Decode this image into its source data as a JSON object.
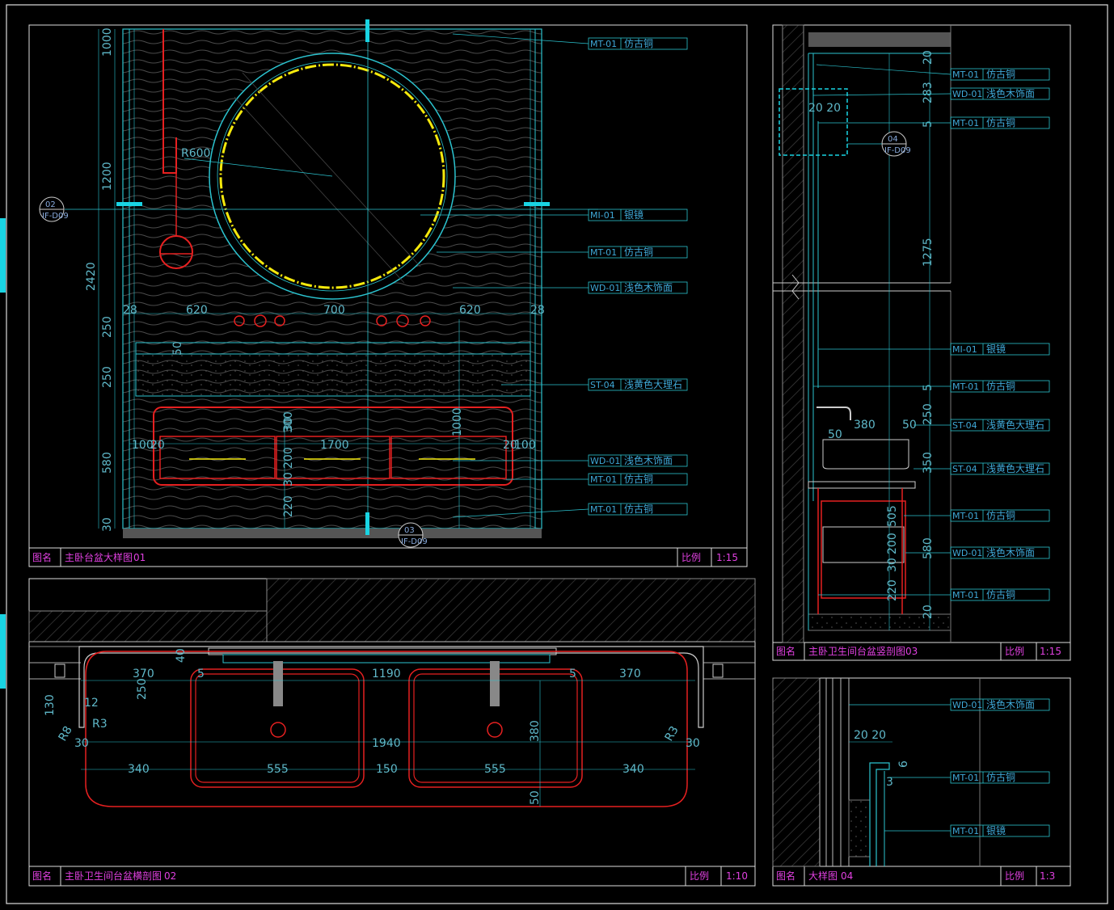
{
  "panels": {
    "p01": {
      "label": "图名",
      "title": "主卧台盆大样图",
      "num": "01",
      "scale_label": "比例",
      "scale": "1:15"
    },
    "p02": {
      "label": "图名",
      "title": "主卧卫生间台盆横剖图",
      "num": "02",
      "scale_label": "比例",
      "scale": "1:10"
    },
    "p03": {
      "label": "图名",
      "title": "主卧卫生间台盆竖剖图",
      "num": "03",
      "scale_label": "比例",
      "scale": "1:15"
    },
    "p04": {
      "label": "图名",
      "title": "大样图",
      "num": "04",
      "scale_label": "比例",
      "scale": "1:3"
    }
  },
  "callouts01": [
    {
      "code": "MT-01",
      "text": "仿古铜"
    },
    {
      "code": "MI-01",
      "text": "银镜"
    },
    {
      "code": "MT-01",
      "text": "仿古铜"
    },
    {
      "code": "WD-01",
      "text": "浅色木饰面"
    },
    {
      "code": "ST-04",
      "text": "浅黄色大理石"
    },
    {
      "code": "WD-01",
      "text": "浅色木饰面"
    },
    {
      "code": "MT-01",
      "text": "仿古铜"
    },
    {
      "code": "MT-01",
      "text": "仿古铜"
    }
  ],
  "callouts03": [
    {
      "code": "MT-01",
      "text": "仿古铜"
    },
    {
      "code": "WD-01",
      "text": "浅色木饰面"
    },
    {
      "code": "MT-01",
      "text": "仿古铜"
    },
    {
      "code": "MI-01",
      "text": "银镜"
    },
    {
      "code": "MT-01",
      "text": "仿古铜"
    },
    {
      "code": "ST-04",
      "text": "浅黄色大理石"
    },
    {
      "code": "ST-04",
      "text": "浅黄色大理石"
    },
    {
      "code": "MT-01",
      "text": "仿古铜"
    },
    {
      "code": "WD-01",
      "text": "浅色木饰面"
    },
    {
      "code": "MT-01",
      "text": "仿古铜"
    }
  ],
  "callouts04": [
    {
      "code": "WD-01",
      "text": "浅色木饰面"
    },
    {
      "code": "MT-01",
      "text": "仿古铜"
    },
    {
      "code": "MT-01",
      "text": "银镜"
    }
  ],
  "dims01": {
    "left": [
      "1000",
      "1200",
      "2420",
      "250",
      "250",
      "580",
      "30"
    ],
    "top": [
      "28",
      "620",
      "700",
      "620",
      "28"
    ],
    "mid": [
      "100",
      "20",
      "1700",
      "20",
      "100",
      "50",
      "30",
      "300",
      "200",
      "30",
      "220",
      "1000"
    ],
    "radius": "R600"
  },
  "dims02": [
    "370",
    "1190",
    "370",
    "40",
    "5",
    "5",
    "250",
    "130",
    "12",
    "R3",
    "R8",
    "R3",
    "30",
    "1940",
    "30",
    "340",
    "555",
    "150",
    "555",
    "340",
    "380",
    "50"
  ],
  "dims03": [
    "20",
    "283",
    "5",
    "20 20",
    "1275",
    "5",
    "250",
    "380",
    "50",
    "50",
    "350",
    "505",
    "200",
    "30",
    "580",
    "220",
    "20"
  ],
  "dims04": [
    "20 20",
    "6",
    "3"
  ],
  "bubbles": [
    {
      "num": "02",
      "ref": "IF-D09"
    },
    {
      "num": "03",
      "ref": "IF-D09"
    },
    {
      "num": "04",
      "ref": "IF-D09"
    }
  ]
}
